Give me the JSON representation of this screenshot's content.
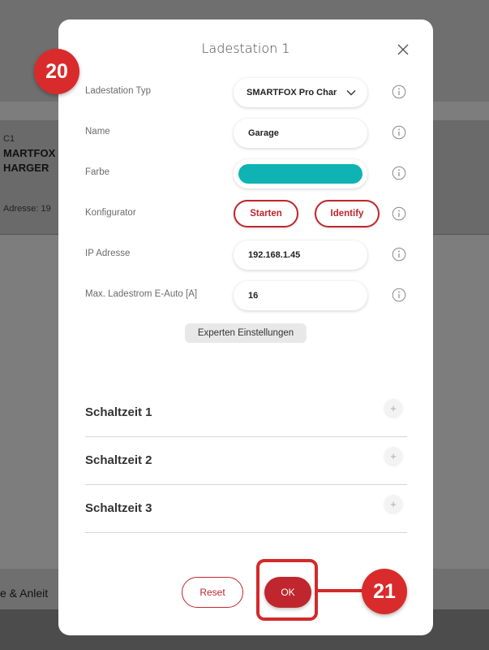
{
  "background": {
    "card_line1": "C1",
    "card_line2": "MARTFOX",
    "card_line3": "HARGER",
    "card_address": "Adresse: 19",
    "bottom_text": "e & Anleit"
  },
  "modal": {
    "title": "Ladestation 1",
    "fields": [
      {
        "label": "Ladestation Typ",
        "value": "SMARTFOX Pro Char"
      },
      {
        "label": "Name",
        "value": "Garage"
      },
      {
        "label": "Farbe",
        "color": "#0fb3b3"
      },
      {
        "label": "Konfigurator",
        "start_label": "Starten",
        "identify_label": "Identify"
      },
      {
        "label": "IP Adresse",
        "value": "192.168.1.45"
      },
      {
        "label": "Max. Ladestrom E-Auto [A]",
        "value": "16"
      }
    ],
    "expert_label": "Experten Einstellungen",
    "sections": [
      {
        "title": "Schaltzeit 1"
      },
      {
        "title": "Schaltzeit 2"
      },
      {
        "title": "Schaltzeit 3"
      }
    ],
    "reset_label": "Reset",
    "ok_label": "OK"
  },
  "markers": {
    "m20": "20",
    "m21": "21"
  },
  "colors": {
    "accent": "#c0262d",
    "marker": "#d92b2b",
    "swatch": "#0fb3b3"
  }
}
